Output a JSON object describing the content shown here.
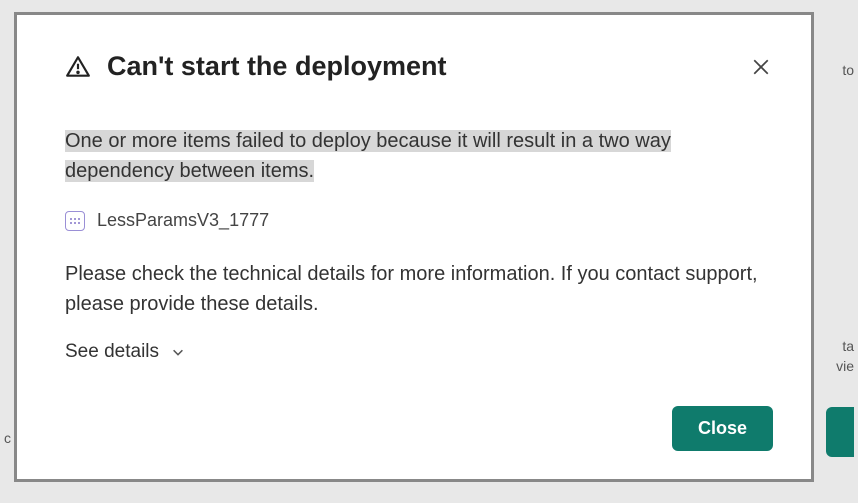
{
  "dialog": {
    "title": "Can't start the deployment",
    "error_message": "One or more items failed to deploy because it will result in a two way dependency between items.",
    "failed_items": [
      {
        "name": "LessParamsV3_1777"
      }
    ],
    "help_text": "Please check the technical details for more information. If you contact support, please provide these details.",
    "see_details_label": "See details",
    "close_button": "Close"
  },
  "background": {
    "frag1": "to",
    "frag2": "ta",
    "frag3": "vie",
    "frag4": "c"
  }
}
